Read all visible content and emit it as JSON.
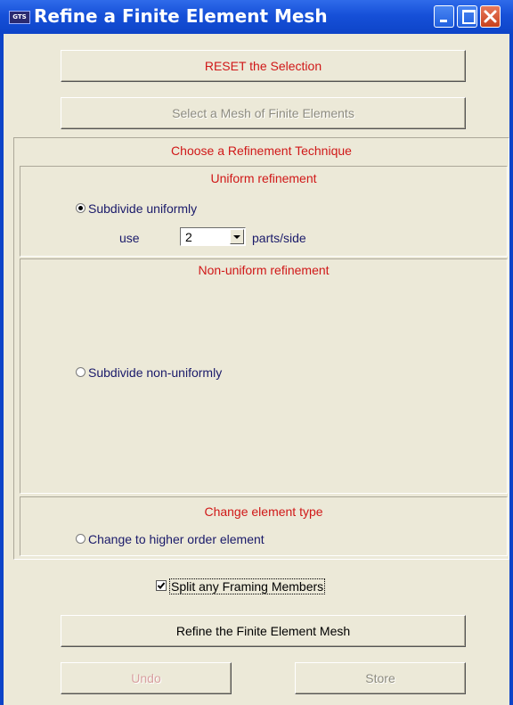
{
  "window": {
    "app_icon": "GTS",
    "title": "Refine a Finite Element Mesh"
  },
  "buttons": {
    "reset": "RESET the Selection",
    "select_mesh": "Select a Mesh of Finite Elements",
    "refine": "Refine the Finite Element Mesh",
    "undo": "Undo",
    "store": "Store"
  },
  "technique": {
    "header": "Choose a Refinement Technique",
    "uniform": {
      "header": "Uniform refinement",
      "option_label": "Subdivide uniformly",
      "selected": true,
      "use_label": "use",
      "parts_value": "2",
      "parts_suffix": "parts/side"
    },
    "nonuniform": {
      "header": "Non-uniform refinement",
      "option_label": "Subdivide non-uniformly",
      "selected": false
    },
    "element_type": {
      "header": "Change element type",
      "option_label": "Change to higher order element",
      "selected": false
    }
  },
  "split_framing": {
    "label": "Split any Framing Members",
    "checked": true
  },
  "colors": {
    "title_bar": "#0d44c8",
    "header_text": "#d01818",
    "label_text": "#1a1a6a",
    "dialog_bg": "#ece9d8"
  }
}
